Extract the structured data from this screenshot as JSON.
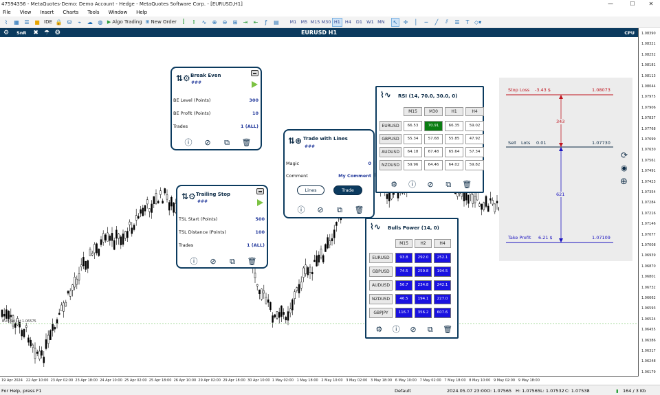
{
  "window": {
    "title": "47594356 - MetaQuotes-Demo: Demo Account - Hedge - MetaQuotes Software Corp. - [EURUSD,H1]",
    "controls": [
      "—",
      "☐",
      "✕"
    ]
  },
  "menu": [
    "File",
    "View",
    "Insert",
    "Charts",
    "Tools",
    "Window",
    "Help"
  ],
  "toolbar": {
    "ide": "IDE",
    "algo_trading": "Algo Trading",
    "new_order": "New Order",
    "timeframes": [
      "M1",
      "M5",
      "M15",
      "M30",
      "H1",
      "H4",
      "D1",
      "W1",
      "MN"
    ],
    "active_timeframe": "H1"
  },
  "chart": {
    "title": "EURUSD H1",
    "header_left": "SnR",
    "cpu": "CPU",
    "bid_label": "BUY/Sell at 1.06575",
    "price_labels": [
      "1.08390",
      "1.08321",
      "1.08252",
      "1.08181",
      "1.08113",
      "1.08044",
      "1.07975",
      "1.07906",
      "1.07837",
      "1.07768",
      "1.07699",
      "1.07630",
      "1.07561",
      "1.07491",
      "1.07423",
      "1.07354",
      "1.07284",
      "1.07216",
      "1.07146",
      "1.07077",
      "1.07008",
      "1.06939",
      "1.06870",
      "1.06801",
      "1.06732",
      "1.06662",
      "1.06593",
      "1.06524",
      "1.06455",
      "1.06386",
      "1.06317",
      "1.06248",
      "1.06179"
    ],
    "time_labels": [
      "19 Apr 2024",
      "22 Apr 10:00",
      "23 Apr 02:00",
      "23 Apr 18:00",
      "24 Apr 10:00",
      "25 Apr 02:00",
      "25 Apr 18:00",
      "26 Apr 10:00",
      "29 Apr 02:00",
      "29 Apr 18:00",
      "30 Apr 10:00",
      "1 May 02:00",
      "1 May 18:00",
      "2 May 10:00",
      "3 May 02:00",
      "3 May 18:00",
      "6 May 10:00",
      "7 May 02:00",
      "7 May 18:00",
      "8 May 10:00",
      "9 May 02:00",
      "9 May 18:00"
    ]
  },
  "break_even": {
    "title": "Break Even",
    "subtitle": "###",
    "rows": [
      {
        "label": "BE Level (Points)",
        "value": "300"
      },
      {
        "label": "BE Profit (Points)",
        "value": "10"
      },
      {
        "label": "Trades",
        "value": "1 (ALL)"
      }
    ]
  },
  "trailing_stop": {
    "title": "Trailing Stop",
    "subtitle": "###",
    "rows": [
      {
        "label": "TSL Start (Points)",
        "value": "500"
      },
      {
        "label": "TSL Distance (Points)",
        "value": "100"
      },
      {
        "label": "Trades",
        "value": "1 (ALL)"
      }
    ]
  },
  "trade_lines": {
    "title": "Trade with Lines",
    "subtitle": "###",
    "rows": [
      {
        "label": "Magic",
        "value": "0"
      },
      {
        "label": "Comment",
        "value": "My Comment"
      }
    ],
    "buttons": [
      "Lines",
      "Trade"
    ]
  },
  "rsi": {
    "title": "RSI (14, 70.0, 30.0, 0)",
    "columns": [
      "M15",
      "M30",
      "H1",
      "H4"
    ],
    "rows": [
      {
        "symbol": "EURUSD",
        "values": [
          "66.53",
          "70.91",
          "66.35",
          "59.02"
        ]
      },
      {
        "symbol": "GBPUSD",
        "values": [
          "55.34",
          "57.68",
          "55.85",
          "47.92"
        ]
      },
      {
        "symbol": "AUDUSD",
        "values": [
          "64.18",
          "67.48",
          "65.64",
          "57.34"
        ]
      },
      {
        "symbol": "NZDUSD",
        "values": [
          "59.96",
          "64.46",
          "64.02",
          "59.82"
        ]
      }
    ],
    "highlight_color": "#0a7d12"
  },
  "bulls_power": {
    "title": "Bulls Power (14, 0)",
    "columns": [
      "M15",
      "H2",
      "H4"
    ],
    "rows": [
      {
        "symbol": "EURUSD",
        "values": [
          "93.8",
          "292.0",
          "252.1"
        ]
      },
      {
        "symbol": "GBPUSD",
        "values": [
          "74.5",
          "259.8",
          "194.5"
        ]
      },
      {
        "symbol": "AUDUSD",
        "values": [
          "56.7",
          "234.8",
          "242.1"
        ]
      },
      {
        "symbol": "NZDUSD",
        "values": [
          "46.5",
          "194.1",
          "227.0"
        ]
      },
      {
        "symbol": "GBPJPY",
        "values": [
          "116.7",
          "356.2",
          "607.6"
        ]
      }
    ],
    "cell_color": "#1a12e0"
  },
  "sltp": {
    "stop_loss_label": "Stop Loss",
    "stop_loss_amount": "-3.43 $",
    "stop_loss_price": "1.08073",
    "sl_points": "343",
    "sell_label": "Sell",
    "lots_label": "Lots",
    "lots_value": "0.01",
    "entry_price": "1.07730",
    "tp_points": "621",
    "take_profit_label": "Take Profit",
    "take_profit_amount": "6.21 $",
    "take_profit_price": "1.07109",
    "sl_color": "#c0141e",
    "tp_color": "#1a12c0"
  },
  "status": {
    "help": "For Help, press F1",
    "profile": "Default",
    "datetime": "2024.05.07 23:00",
    "o": "O: 1.07565",
    "h": "H: 1.07565",
    "l": "L: 1.07532",
    "c": "C: 1.07538",
    "net": "164 / 3 Kb"
  }
}
